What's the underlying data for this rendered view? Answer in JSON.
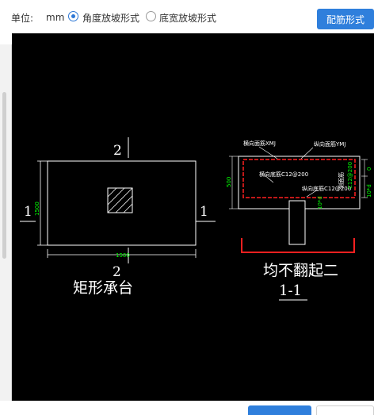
{
  "toolbar": {
    "unit_label": "单位:",
    "unit_value": "mm",
    "radio_options": [
      {
        "label": "角度放坡形式",
        "checked": true
      },
      {
        "label": "底宽放坡形式",
        "checked": false
      }
    ],
    "rebar_form_button": "配筋形式"
  },
  "drawing": {
    "plan": {
      "section_mark_top": "2",
      "section_mark_bottom": "2",
      "section_mark_left": "1",
      "section_mark_right": "1",
      "dim_width": "1500",
      "dim_height": "1500",
      "title": "矩形承台"
    },
    "section": {
      "top_bar_label": "横向面筋XMJ",
      "top_bar_label_2": "纵向面筋YMJ",
      "bottom_bar_label": "横向底筋C12@200",
      "bottom_bar_label_2": "纵向底筋C12@200",
      "side_label": "侧面筋",
      "side_spec": "C12@200",
      "dim_height": "500",
      "dim_right_top": "0",
      "dim_right_bottom": "10*d",
      "dim_bottom_small": "10*d",
      "note": "均不翻起二",
      "title": "1-1"
    },
    "colors": {
      "background": "#000000",
      "line": "#ffffff",
      "rebar": "#ff2020",
      "dimension": "#00ff00"
    }
  },
  "footer": {
    "primary_button": "",
    "secondary_button": ""
  }
}
